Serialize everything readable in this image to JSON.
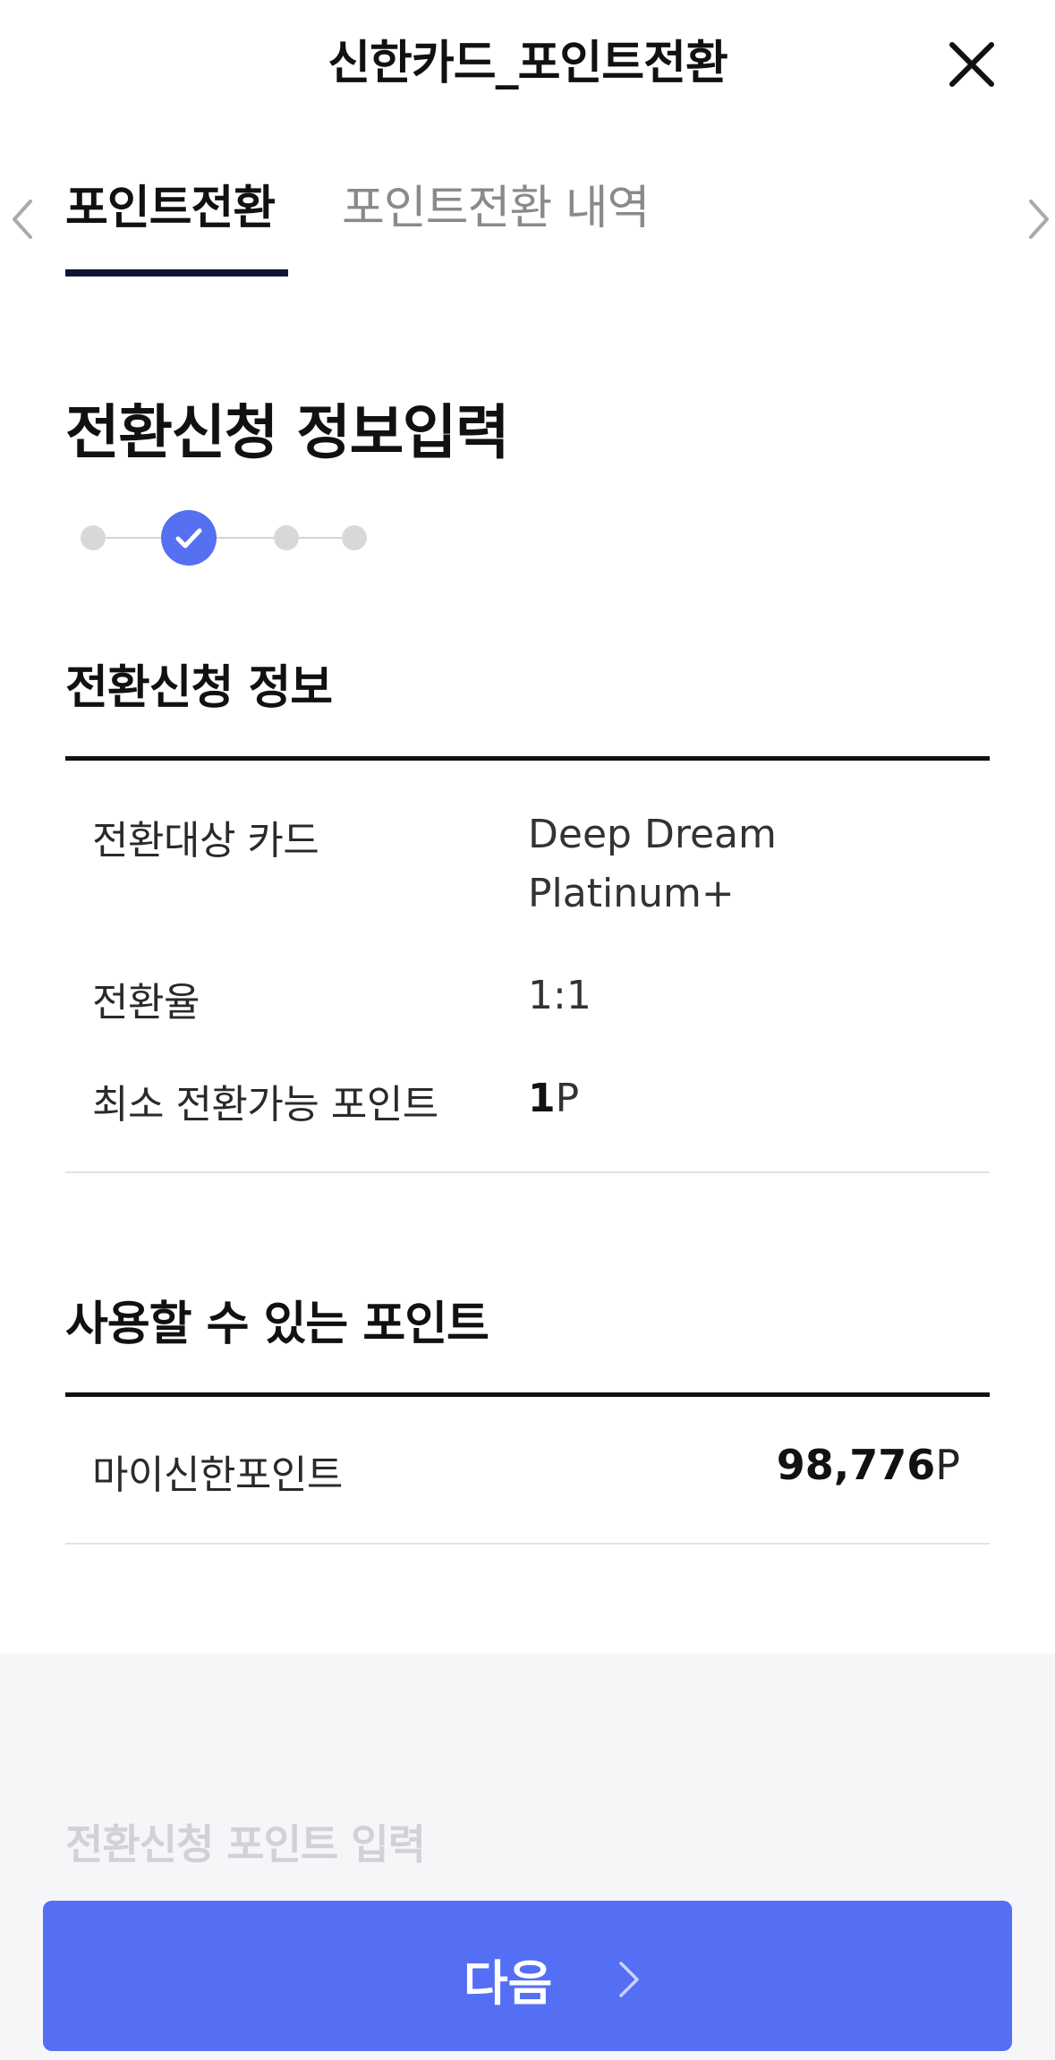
{
  "header": {
    "title": "신한카드_포인트전환"
  },
  "tabs": [
    {
      "label": "포인트전환",
      "active": true
    },
    {
      "label": "포인트전환 내역",
      "active": false
    }
  ],
  "page_title": "전환신청 정보입력",
  "stepper": {
    "total_steps": 4,
    "current_step": 2
  },
  "conversion_info": {
    "title": "전환신청 정보",
    "rows": [
      {
        "label": "전환대상 카드",
        "value_line1": "Deep Dream",
        "value_line2": "Platinum+"
      },
      {
        "label": "전환율",
        "value": "1:1"
      },
      {
        "label": "최소 전환가능 포인트",
        "value_number": "1",
        "value_unit": "P"
      }
    ]
  },
  "available_points": {
    "title": "사용할 수 있는 포인트",
    "rows": [
      {
        "label": "마이신한포인트",
        "value_number": "98,776",
        "value_unit": "P"
      }
    ]
  },
  "input_section": {
    "title": "전환신청 포인트 입력"
  },
  "footer": {
    "next_label": "다음"
  },
  "colors": {
    "accent": "#546ff4",
    "tab_underline": "#0d1638",
    "step_active": "#5570f0",
    "step_inactive": "#d8d8d8"
  }
}
